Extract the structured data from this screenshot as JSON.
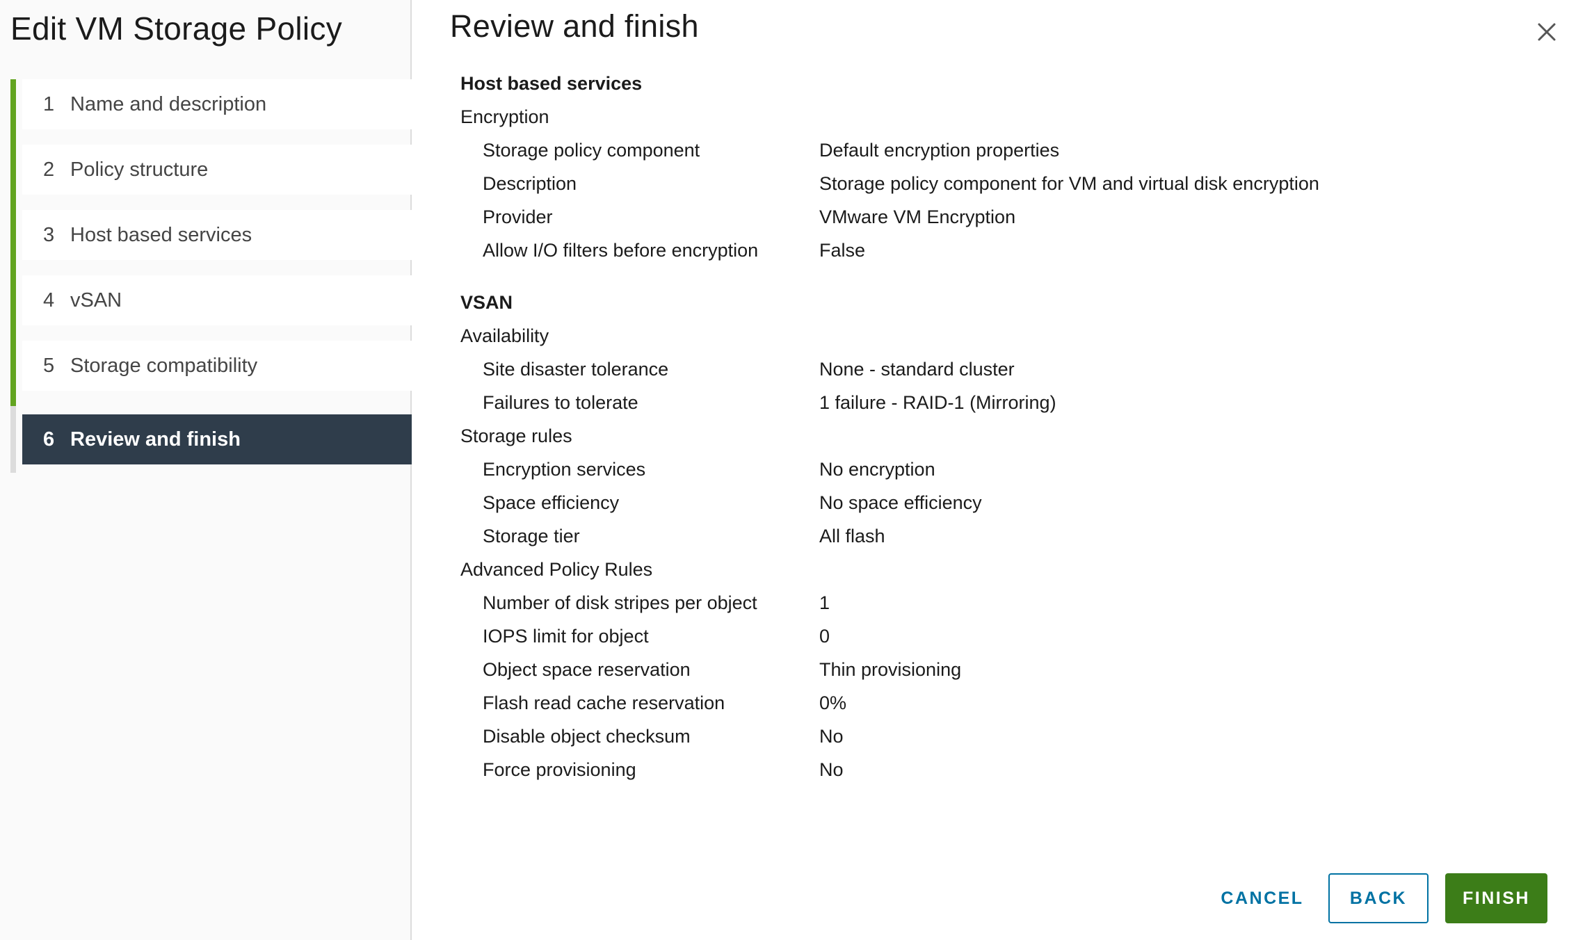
{
  "wizard": {
    "title": "Edit VM Storage Policy"
  },
  "steps": [
    {
      "number": "1",
      "label": "Name and description"
    },
    {
      "number": "2",
      "label": "Policy structure"
    },
    {
      "number": "3",
      "label": "Host based services"
    },
    {
      "number": "4",
      "label": "vSAN"
    },
    {
      "number": "5",
      "label": "Storage compatibility"
    },
    {
      "number": "6",
      "label": "Review and finish"
    }
  ],
  "main": {
    "title": "Review and finish"
  },
  "host_based": {
    "heading": "Host based services",
    "encryption": {
      "label": "Encryption",
      "rows": [
        {
          "key": "Storage policy component",
          "value": "Default encryption properties"
        },
        {
          "key": "Description",
          "value": "Storage policy component for VM and virtual disk encryption"
        },
        {
          "key": "Provider",
          "value": "VMware VM Encryption"
        },
        {
          "key": "Allow I/O filters before encryption",
          "value": "False"
        }
      ]
    }
  },
  "vsan": {
    "heading": "VSAN",
    "availability": {
      "label": "Availability",
      "rows": [
        {
          "key": "Site disaster tolerance",
          "value": "None - standard cluster"
        },
        {
          "key": "Failures to tolerate",
          "value": "1 failure - RAID-1 (Mirroring)"
        }
      ]
    },
    "storage_rules": {
      "label": "Storage rules",
      "rows": [
        {
          "key": "Encryption services",
          "value": "No encryption"
        },
        {
          "key": "Space efficiency",
          "value": "No space efficiency"
        },
        {
          "key": "Storage tier",
          "value": "All flash"
        }
      ]
    },
    "advanced": {
      "label": "Advanced Policy Rules",
      "rows": [
        {
          "key": "Number of disk stripes per object",
          "value": "1"
        },
        {
          "key": "IOPS limit for object",
          "value": "0"
        },
        {
          "key": "Object space reservation",
          "value": "Thin provisioning"
        },
        {
          "key": "Flash read cache reservation",
          "value": "0%"
        },
        {
          "key": "Disable object checksum",
          "value": "No"
        },
        {
          "key": "Force provisioning",
          "value": "No"
        }
      ]
    }
  },
  "footer": {
    "cancel": "CANCEL",
    "back": "BACK",
    "finish": "FINISH"
  },
  "icons": {
    "close": "close-icon"
  },
  "colors": {
    "progress": "#62a420",
    "active_step_bg": "#2f3d4b",
    "link_blue": "#0072a3",
    "finish_green": "#3c7d18"
  }
}
